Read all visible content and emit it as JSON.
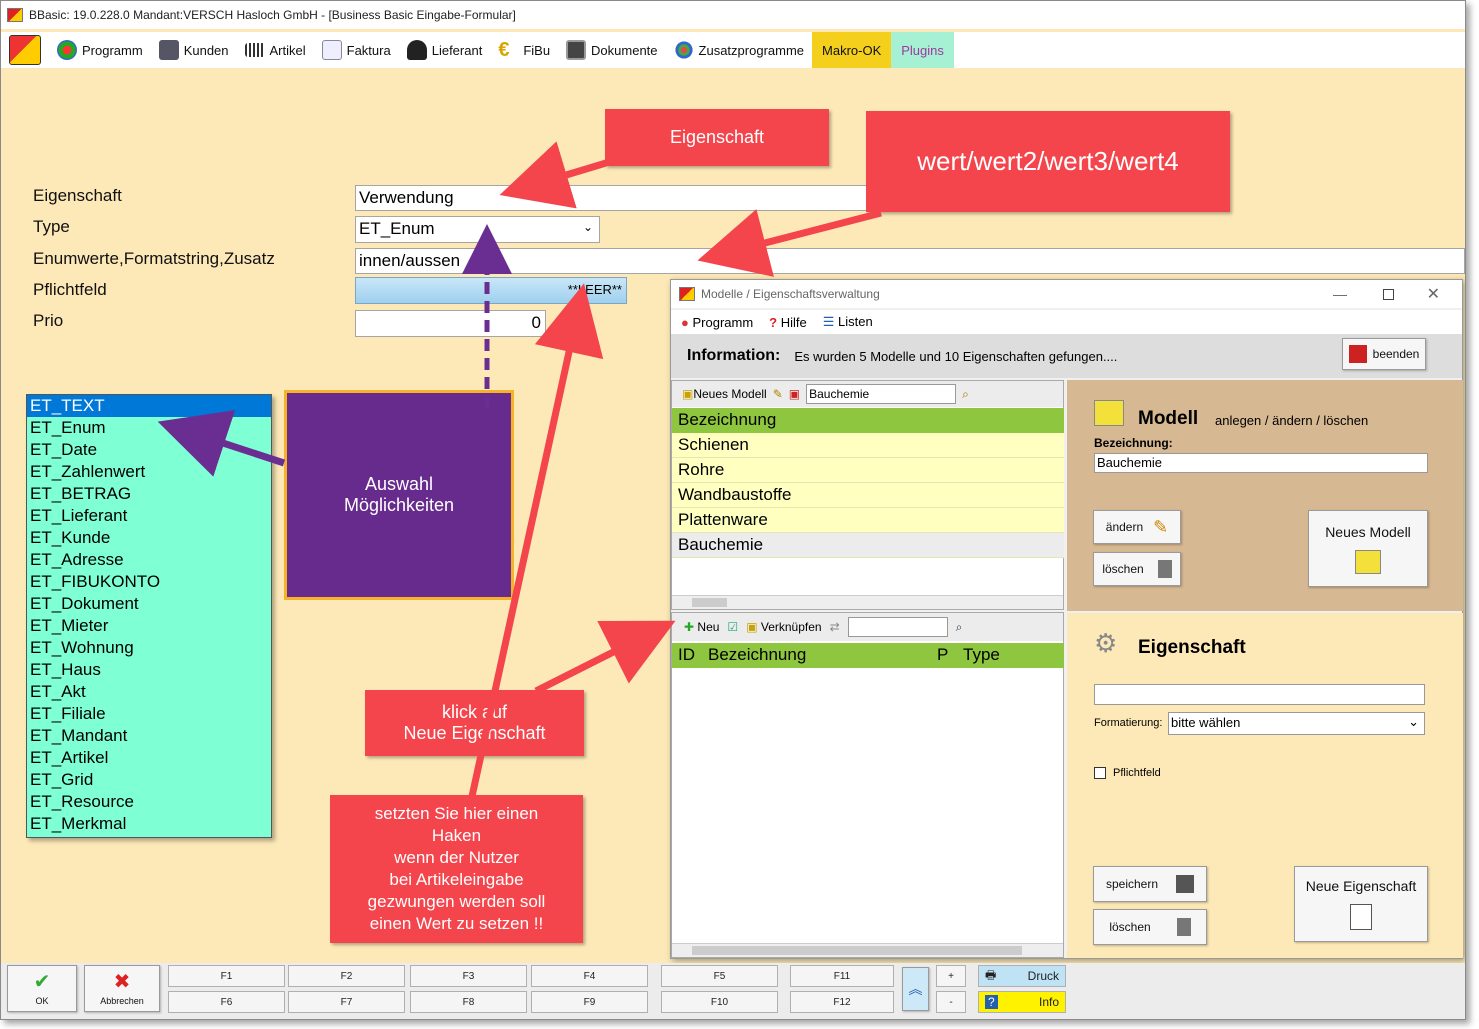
{
  "window_title": "BBasic: 19.0.228.0 Mandant:VERSCH Hasloch GmbH  - [Business Basic Eingabe-Formular]",
  "menu": [
    "Programm",
    "Kunden",
    "Artikel",
    "Faktura",
    "Lieferant",
    "FiBu",
    "Dokumente",
    "Zusatzprogramme",
    "Makro-OK",
    "Plugins"
  ],
  "form": {
    "labels": [
      "Eigenschaft",
      "Type",
      "Enumwerte,Formatstring,Zusatz",
      "Pflichtfeld",
      "Prio"
    ],
    "eigenschaft": "Verwendung",
    "type": "ET_Enum",
    "enum": "innen/aussen",
    "pflichtfeld": "**LEER**",
    "prio": "0"
  },
  "dropdown": [
    "ET_TEXT",
    "ET_Enum",
    "ET_Date",
    "ET_Zahlenwert",
    "ET_BETRAG",
    "ET_Lieferant",
    "ET_Kunde",
    "ET_Adresse",
    "ET_FIBUKONTO",
    "ET_Dokument",
    "ET_Mieter",
    "ET_Wohnung",
    "ET_Haus",
    "ET_Akt",
    "ET_Filiale",
    "ET_Mandant",
    "ET_Artikel",
    "ET_Grid",
    "ET_Resource",
    "ET_Merkmal"
  ],
  "callouts": {
    "eigenschaft": "Eigenschaft",
    "wert": "wert/wert2/wert3/wert4",
    "auswahl1": "Auswahl",
    "auswahl2": "Möglichkeiten",
    "klick1": "klick auf",
    "klick2": "Neue Eigenschaft",
    "haken": [
      "setzten Sie hier einen",
      "Haken",
      "wenn der Nutzer",
      "bei Artikeleingabe",
      "gezwungen werden soll",
      "einen Wert zu setzen !!"
    ]
  },
  "dialog": {
    "title": "Modelle / Eigenschaftsverwaltung",
    "menu": [
      "Programm",
      "Hilfe",
      "Listen"
    ],
    "info_label": "Information:",
    "info_text": "Es wurden  5  Modelle  und 10  Eigenschaften gefungen....",
    "beenden": "beenden",
    "toolbar1": {
      "neues_modell": "Neues Modell",
      "search": "Bauchemie"
    },
    "list1_header": "Bezeichnung",
    "list1": [
      "Schienen",
      "Rohre",
      "Wandbaustoffe",
      "Plattenware",
      "Bauchemie"
    ],
    "toolbar2": {
      "neu": "Neu",
      "verknuepfen": "Verknüpfen"
    },
    "list2_headers": [
      "ID",
      "Bezeichnung",
      "P",
      "Type"
    ],
    "modell": {
      "title": "Modell",
      "subtitle": "anlegen / ändern / löschen",
      "bez_label": "Bezeichnung:",
      "bez_value": "Bauchemie",
      "aendern": "ändern",
      "loeschen": "löschen",
      "neues_modell": "Neues  Modell"
    },
    "eigenschaft": {
      "title": "Eigenschaft",
      "format_label": "Formatierung:",
      "format_value": "bitte wählen",
      "pflicht": "Pflichtfeld",
      "speichern": "speichern",
      "loeschen": "löschen",
      "neue": "Neue Eigenschaft"
    }
  },
  "footer": {
    "ok": "OK",
    "abbrechen": "Abbrechen",
    "fkeys": [
      "F1",
      "F2",
      "F3",
      "F4",
      "F5",
      "F11",
      "F6",
      "F7",
      "F8",
      "F9",
      "F10",
      "F12"
    ],
    "plus": "+",
    "minus": "-",
    "druck": "Druck",
    "info": "Info"
  }
}
